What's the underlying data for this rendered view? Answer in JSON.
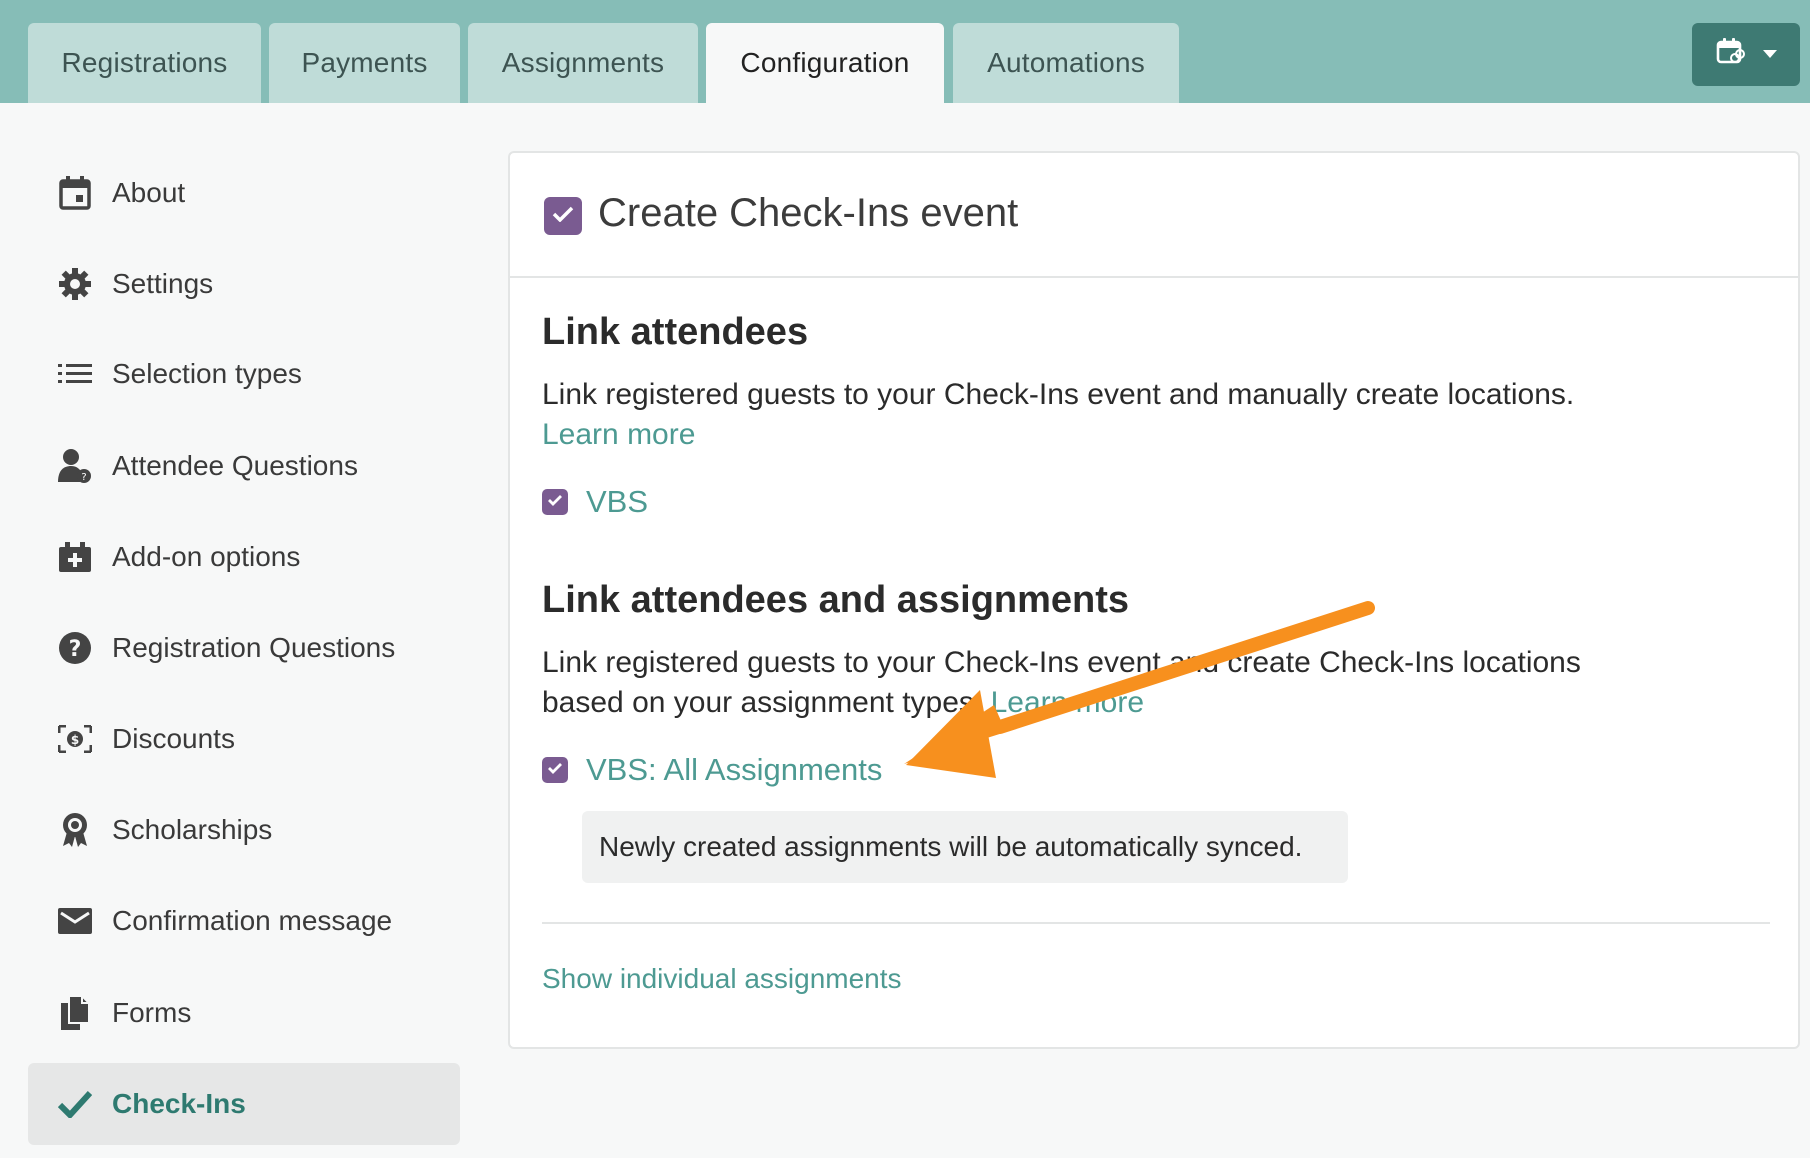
{
  "tabs": [
    {
      "label": "Registrations",
      "active": false
    },
    {
      "label": "Payments",
      "active": false
    },
    {
      "label": "Assignments",
      "active": false
    },
    {
      "label": "Configuration",
      "active": true
    },
    {
      "label": "Automations",
      "active": false
    }
  ],
  "header_actions": {
    "calendar_icon": "calendar-link-icon",
    "dropdown_icon": "caret-down-icon"
  },
  "sidebar": {
    "items": [
      {
        "label": "About",
        "icon": "calendar-icon"
      },
      {
        "label": "Settings",
        "icon": "gear-icon"
      },
      {
        "label": "Selection types",
        "icon": "list-icon"
      },
      {
        "label": "Attendee Questions",
        "icon": "person-question-icon"
      },
      {
        "label": "Add-on options",
        "icon": "add-box-icon"
      },
      {
        "label": "Registration Questions",
        "icon": "question-circle-icon"
      },
      {
        "label": "Discounts",
        "icon": "money-icon"
      },
      {
        "label": "Scholarships",
        "icon": "ribbon-icon"
      },
      {
        "label": "Confirmation message",
        "icon": "envelope-icon"
      },
      {
        "label": "Forms",
        "icon": "documents-icon"
      },
      {
        "label": "Check-Ins",
        "icon": "checkmark-icon",
        "active": true
      }
    ]
  },
  "main": {
    "title": "Create Check-Ins event",
    "title_checked": true,
    "section1": {
      "heading": "Link attendees",
      "text": "Link registered guests to your Check-Ins event and manually create locations.",
      "learn_more": "Learn more",
      "option_label": "VBS",
      "option_checked": true
    },
    "section2": {
      "heading": "Link attendees and assignments",
      "text_line1": "Link registered guests to your Check-Ins event and create Check-Ins locations",
      "text_line2": "based on your assignment types.",
      "learn_more": "Learn more",
      "option_label": "VBS: All Assignments",
      "option_checked": true,
      "note": "Newly created assignments will be automatically synced."
    },
    "show_individual": "Show individual assignments"
  },
  "colors": {
    "topbar": "#86bdb7",
    "tab_inactive": "#bfdcd8",
    "accent_teal": "#4d9a92",
    "checkbox_purple": "#7a5b91",
    "annotation_arrow": "#f7901e"
  }
}
